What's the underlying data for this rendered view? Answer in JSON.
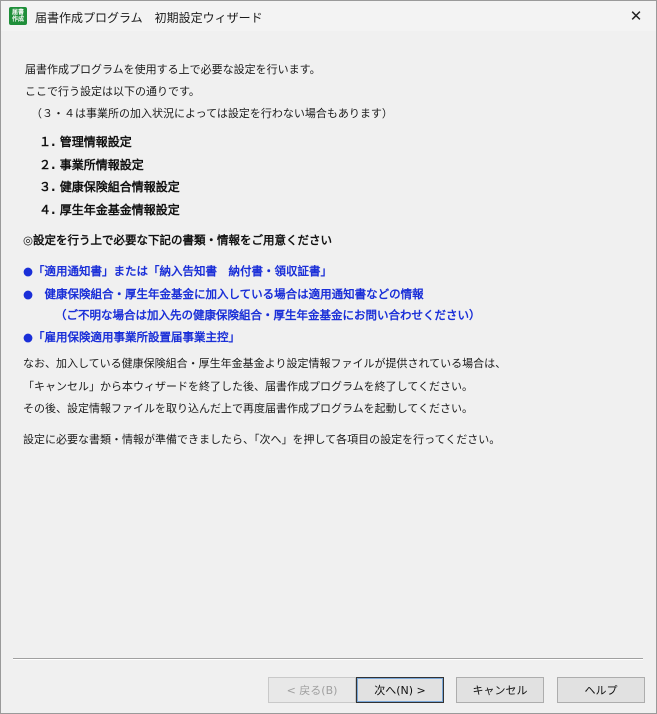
{
  "window": {
    "app_icon_text": "届書作成",
    "title": "届書作成プログラム　初期設定ウィザード",
    "close_glyph": "✕"
  },
  "intro": {
    "line1": "届書作成プログラムを使用する上で必要な設定を行います。",
    "line2": "ここで行う設定は以下の通りです。",
    "line3": "（３・４は事業所の加入状況によっては設定を行わない場合もあります）"
  },
  "steps": [
    "１. 管理情報設定",
    "２. 事業所情報設定",
    "３. 健康保険組合情報設定",
    "４. 厚生年金基金情報設定"
  ],
  "documents_heading": "◎設定を行う上で必要な下記の書類・情報をご用意ください",
  "documents": {
    "item1": "●「適用通知書」または「納入告知書　納付書・領収証書」",
    "item2": "●　健康保険組合・厚生年金基金に加入している場合は適用通知書などの情報",
    "item2_note": "（ご不明な場合は加入先の健康保険組合・厚生年金基金にお問い合わせください）",
    "item3": "●「雇用保険適用事業所設置届事業主控」"
  },
  "notes": {
    "line1": "なお、加入している健康保険組合・厚生年金基金より設定情報ファイルが提供されている場合は、",
    "line2": "「キャンセル」から本ウィザードを終了した後、届書作成プログラムを終了してください。",
    "line3": "その後、設定情報ファイルを取り込んだ上で再度届書作成プログラムを起動してください。",
    "line4": "設定に必要な書類・情報が準備できましたら、「次へ」を押して各項目の設定を行ってください。"
  },
  "buttons": {
    "back": "< 戻る(B)",
    "next": "次へ(N) >",
    "cancel": "キャンセル",
    "help": "ヘルプ"
  }
}
